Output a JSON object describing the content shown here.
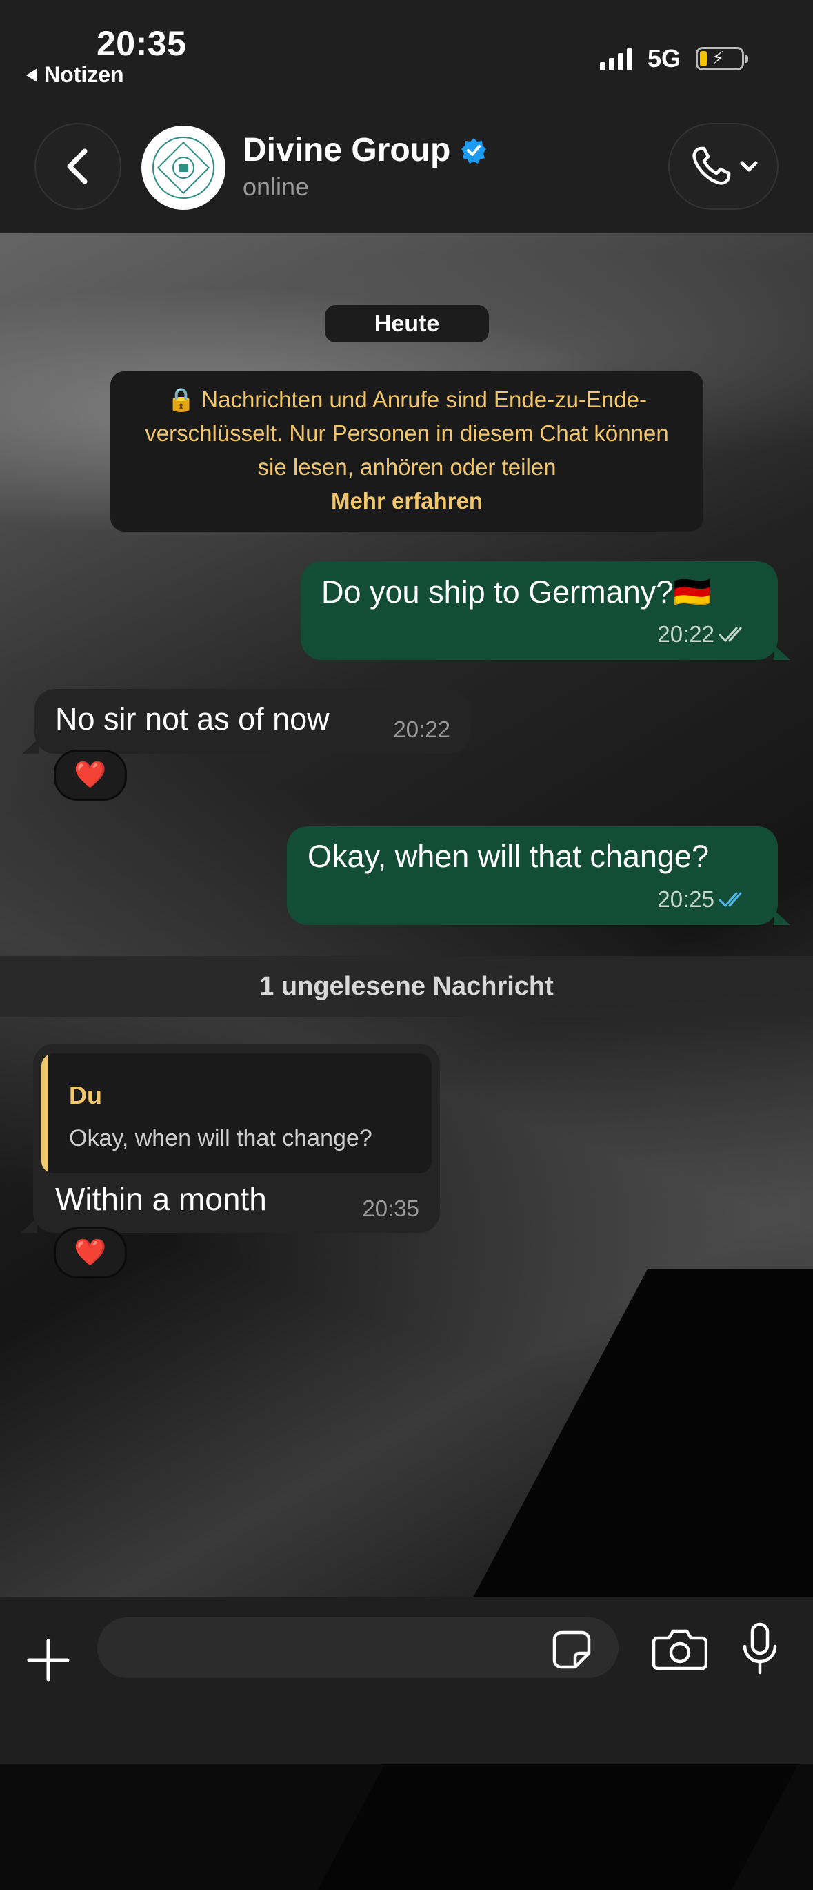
{
  "status_bar": {
    "time": "20:35",
    "back_app": "Notizen",
    "network": "5G"
  },
  "header": {
    "title": "Divine Group",
    "subtitle": "online",
    "verified": true
  },
  "chat": {
    "date_label": "Heute",
    "encryption_notice": "🔒 Nachrichten und Anrufe sind Ende-zu-Ende-verschlüsselt. Nur Personen in diesem Chat können sie lesen, anhören oder teilen",
    "encryption_link": "Mehr erfahren",
    "unread_label": "1 ungelesene Nachricht",
    "messages": [
      {
        "direction": "out",
        "text": "Do you ship to Germany?🇩🇪",
        "time": "20:22",
        "status": "delivered"
      },
      {
        "direction": "in",
        "text": "No sir not as of now",
        "time": "20:22",
        "reaction": "❤️"
      },
      {
        "direction": "out",
        "text": "Okay, when will that change?",
        "time": "20:25",
        "status": "read"
      },
      {
        "direction": "in",
        "reply_to": {
          "author": "Du",
          "text": "Okay, when will that change?"
        },
        "text": "Within a month",
        "time": "20:35",
        "reaction": "❤️"
      }
    ]
  },
  "composer": {
    "placeholder": ""
  },
  "colors": {
    "outgoing_bubble": "#134d37",
    "incoming_bubble": "#242424",
    "notice_text": "#f2c66d",
    "read_ticks": "#4fb6ec",
    "verified_badge": "#1d9bf0"
  },
  "icons": {
    "back": "chevron-left-icon",
    "call": "phone-icon",
    "plus": "plus-icon",
    "sticker": "sticker-icon",
    "camera": "camera-icon",
    "mic": "mic-icon"
  }
}
